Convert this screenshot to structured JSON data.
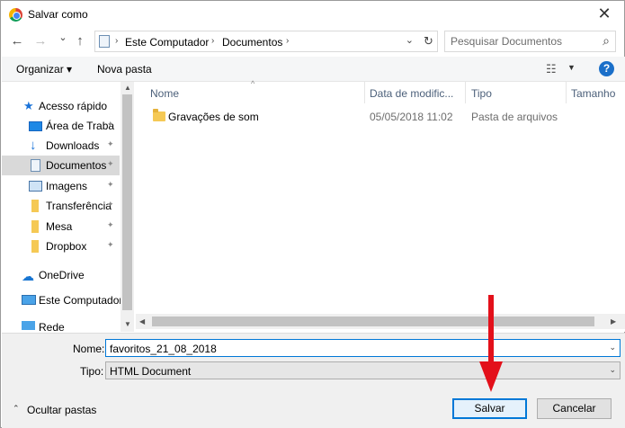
{
  "window": {
    "title": "Salvar como",
    "close_glyph": "✕"
  },
  "nav": {
    "back_glyph": "←",
    "forward_glyph": "→",
    "recent_glyph": "⌄",
    "up_glyph": "↑",
    "breadcrumb": [
      "Este Computador",
      "Documentos"
    ],
    "breadcrumb_sep": "›",
    "refresh_glyph": "↻",
    "search_placeholder": "Pesquisar Documentos",
    "search_glyph": "⌕"
  },
  "toolbar": {
    "organize_label": "Organizar ▾",
    "new_folder_label": "Nova pasta",
    "view_glyph": "☷",
    "view_dd": "▼",
    "help_glyph": "?"
  },
  "sidebar": {
    "items": [
      {
        "label": "Acesso rápido",
        "icon": "star-icon",
        "pinned": false
      },
      {
        "label": "Área de Traba",
        "icon": "desktop-icon",
        "pinned": true
      },
      {
        "label": "Downloads",
        "icon": "download-icon",
        "pinned": true
      },
      {
        "label": "Documentos",
        "icon": "documents-icon",
        "pinned": true,
        "selected": true
      },
      {
        "label": "Imagens",
        "icon": "pictures-icon",
        "pinned": true
      },
      {
        "label": "Transferência",
        "icon": "folder-icon",
        "pinned": true
      },
      {
        "label": "Mesa",
        "icon": "folder-icon",
        "pinned": true
      },
      {
        "label": "Dropbox",
        "icon": "folder-icon",
        "pinned": true
      },
      {
        "label": "OneDrive",
        "icon": "onedrive-icon",
        "pinned": false
      },
      {
        "label": "Este Computador",
        "icon": "computer-icon",
        "pinned": false
      },
      {
        "label": "Rede",
        "icon": "network-icon",
        "pinned": false
      }
    ],
    "pin_glyph": "📌"
  },
  "filelist": {
    "columns": [
      "Nome",
      "Data de modific...",
      "Tipo",
      "Tamanho"
    ],
    "sort_glyph": "^",
    "rows": [
      {
        "name": "Gravações de som",
        "date": "05/05/2018 11:02",
        "type": "Pasta de arquivos",
        "size": ""
      }
    ]
  },
  "form": {
    "name_label": "Nome:",
    "name_value": "favoritos_21_08_2018",
    "type_label": "Tipo:",
    "type_value": "HTML Document",
    "dd_glyph": "⌄"
  },
  "footer": {
    "hide_folders_label": "Ocultar pastas",
    "hide_chevron": "⌃",
    "save_label": "Salvar",
    "cancel_label": "Cancelar"
  },
  "colors": {
    "accent": "#0078d7",
    "annotation_arrow": "#e3101a",
    "help": "#1a6fc9"
  }
}
